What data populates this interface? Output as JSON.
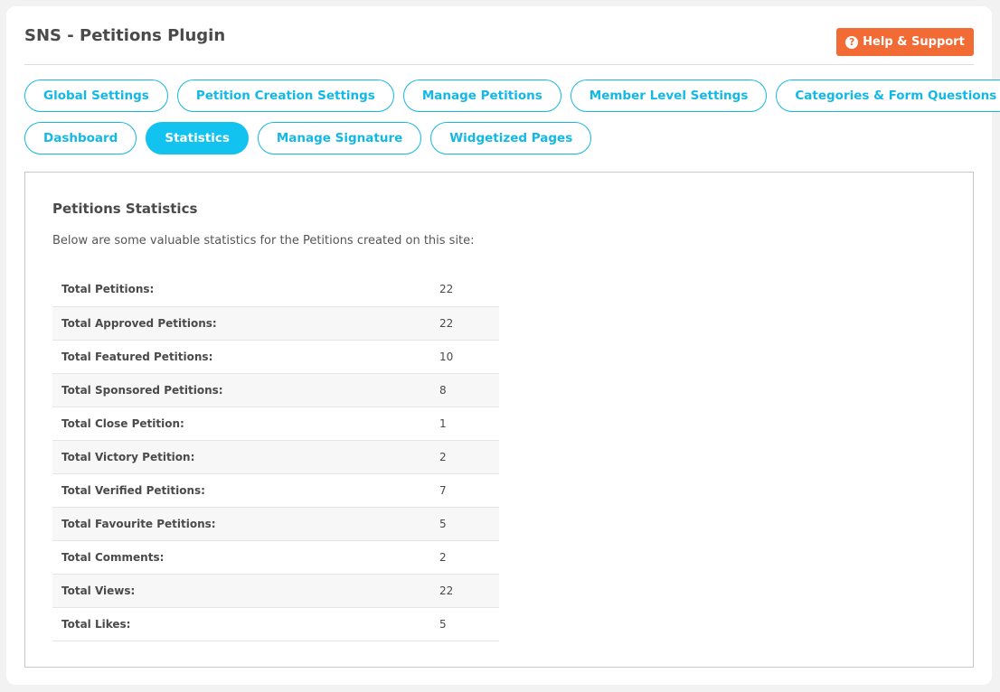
{
  "header": {
    "title": "SNS - Petitions Plugin",
    "help_label": "Help & Support",
    "help_icon": "question-circle-icon",
    "accent": "#f26b35"
  },
  "tabs": {
    "row1": [
      {
        "label": "Global Settings",
        "active": false
      },
      {
        "label": "Petition Creation Settings",
        "active": false
      },
      {
        "label": "Manage Petitions",
        "active": false
      },
      {
        "label": "Member Level Settings",
        "active": false
      },
      {
        "label": "Categories & Form Questions",
        "active": false
      }
    ],
    "row2": [
      {
        "label": "Dashboard",
        "active": false
      },
      {
        "label": "Statistics",
        "active": true
      },
      {
        "label": "Manage Signature",
        "active": false
      },
      {
        "label": "Widgetized Pages",
        "active": false
      }
    ],
    "accent": "#12c2ef"
  },
  "panel": {
    "title": "Petitions Statistics",
    "description": "Below are some valuable statistics for the Petitions created on this site:",
    "stats": [
      {
        "label": "Total Petitions:",
        "value": "22"
      },
      {
        "label": "Total Approved Petitions:",
        "value": "22"
      },
      {
        "label": "Total Featured Petitions:",
        "value": "10"
      },
      {
        "label": "Total Sponsored Petitions:",
        "value": "8"
      },
      {
        "label": "Total Close Petition:",
        "value": "1"
      },
      {
        "label": "Total Victory Petition:",
        "value": "2"
      },
      {
        "label": "Total Verified Petitions:",
        "value": "7"
      },
      {
        "label": "Total Favourite Petitions:",
        "value": "5"
      },
      {
        "label": "Total Comments:",
        "value": "2"
      },
      {
        "label": "Total Views:",
        "value": "22"
      },
      {
        "label": "Total Likes:",
        "value": "5"
      }
    ]
  }
}
